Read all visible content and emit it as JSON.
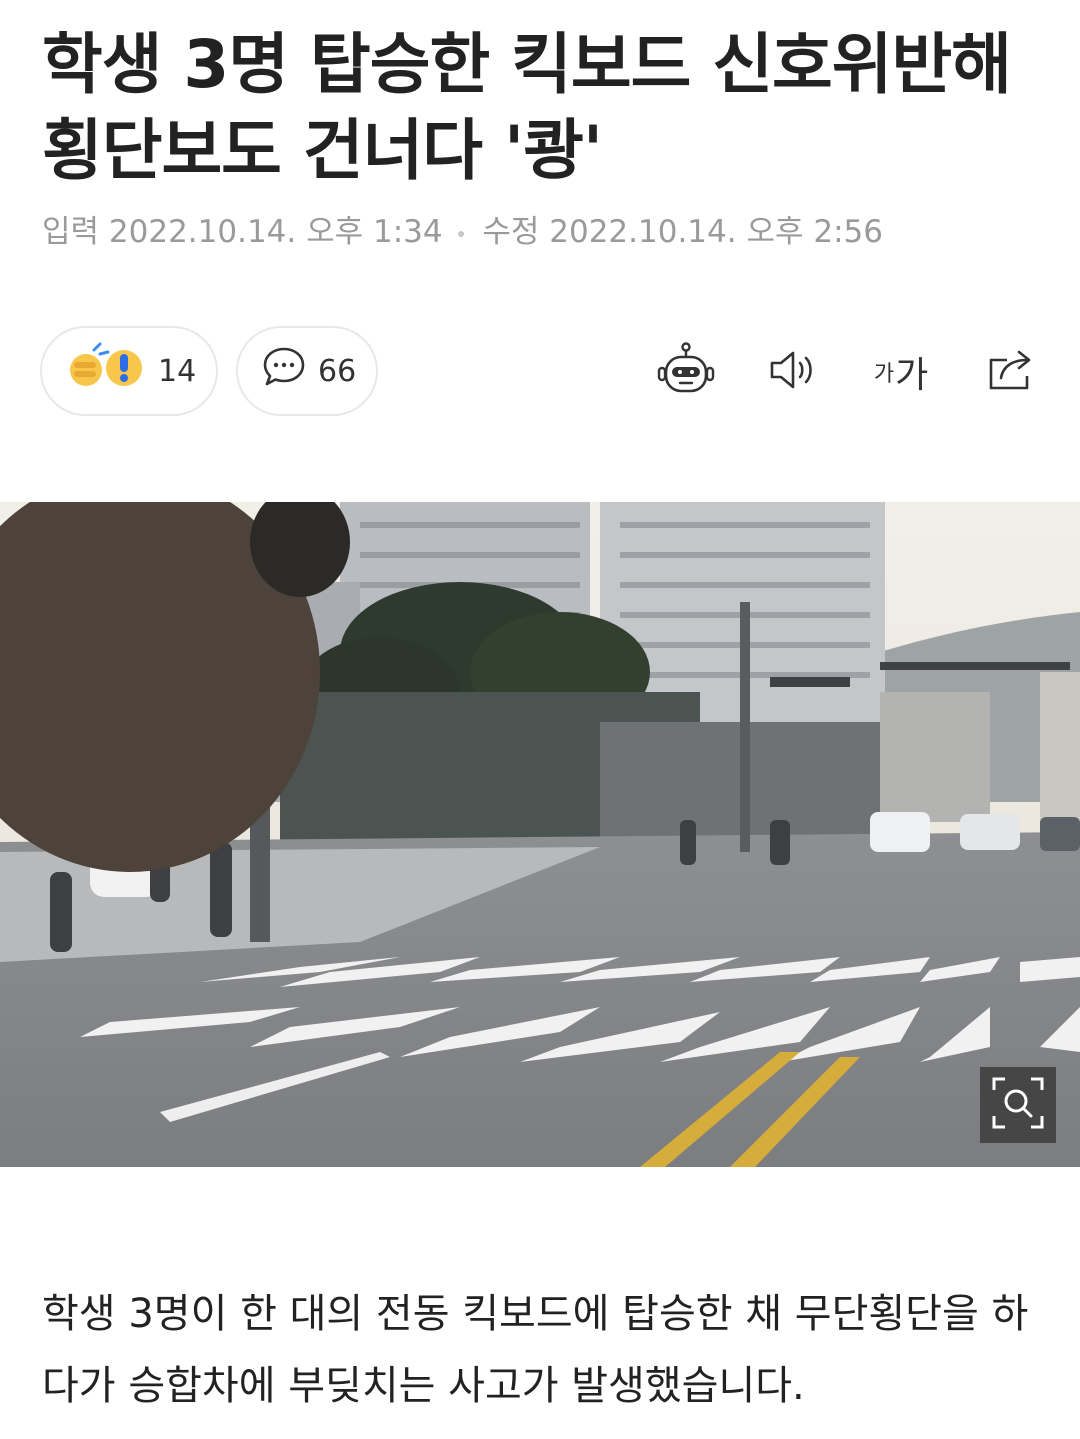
{
  "article": {
    "headline": "학생 3명 탑승한 킥보드 신호위반해 횡단보도 건너다 '쾅'",
    "meta": {
      "input_label": "입력",
      "input_time": "2022.10.14. 오후 1:34",
      "edit_label": "수정",
      "edit_time": "2022.10.14. 오후 2:56"
    },
    "reactions": {
      "count": "14",
      "icon": "reaction-emoji-icon"
    },
    "comments": {
      "count": "66",
      "icon": "comment-icon"
    },
    "tools": {
      "font_small": "가",
      "font_large": "가",
      "icons": [
        "summary-bot-icon",
        "speaker-icon",
        "font-size-icon",
        "share-icon"
      ]
    },
    "photo": {
      "zoom_icon": "zoom-search-icon"
    },
    "body": " 학생 3명이 한 대의 전동 킥보드에 탑승한 채 무단횡단을 하다가 승합차에 부딪치는 사고가 발생했습니다."
  }
}
